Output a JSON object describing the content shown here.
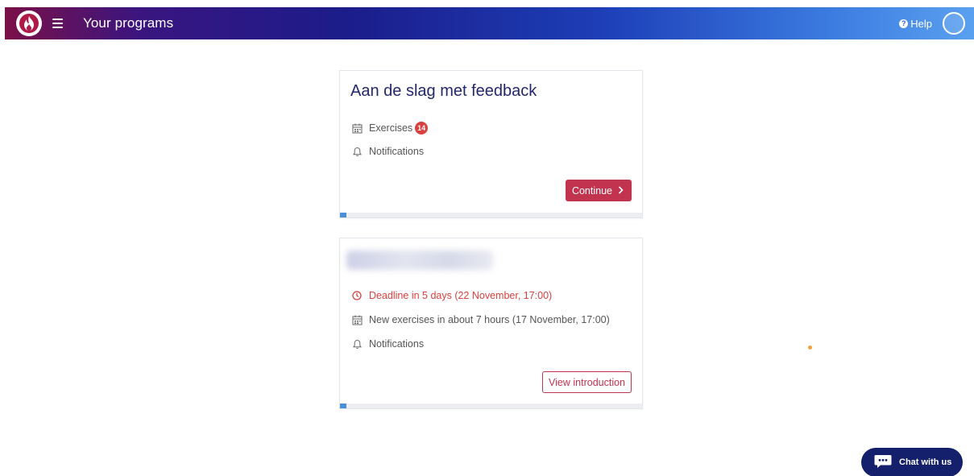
{
  "header": {
    "title": "Your programs",
    "help_label": "Help",
    "help_icon_glyph": "?",
    "logo_icon": "flame-logo-icon",
    "menu_icon": "hamburger-menu-icon",
    "colors": {
      "gradient_start": "#7a1048",
      "gradient_mid": "#1b1c8a",
      "gradient_end": "#5aa0f0"
    }
  },
  "programs": [
    {
      "title": "Aan de slag met feedback",
      "exercises_label": "Exercises",
      "exercises_count": "14",
      "notifications_label": "Notifications",
      "button_label": "Continue",
      "progress": 0.02
    },
    {
      "title": "",
      "title_blurred": true,
      "deadline_label": "Deadline in 5 days (22 November, 17:00)",
      "new_exercises_label": "New exercises in about 7 hours (17 November, 17:00)",
      "notifications_label": "Notifications",
      "button_label": "View introduction",
      "progress": 0.02
    }
  ],
  "chat": {
    "label": "Chat with us",
    "icon": "chat-bubble-icon"
  },
  "colors": {
    "accent": "#c1334e",
    "badge": "#d8413f",
    "progress": "#4a8fd8",
    "chat_bg": "#14206b"
  }
}
